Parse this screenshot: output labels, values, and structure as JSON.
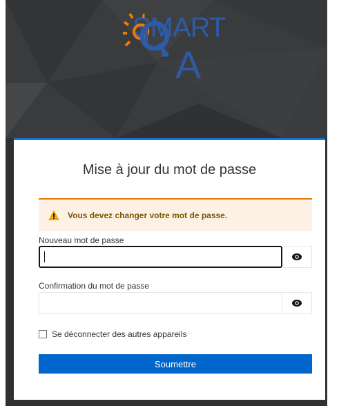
{
  "logo": {
    "text_top": "SMART",
    "text_bottom": "A",
    "brand_color": "#2e5aa6",
    "accent_color": "#ec7a08"
  },
  "card": {
    "title": "Mise à jour du mot de passe",
    "accent_color": "#1a73c8"
  },
  "alert": {
    "icon": "warning-icon",
    "message": "Vous devez changer votre mot de passe.",
    "background": "#fdf1e6",
    "border_color": "#ec7a08"
  },
  "new_password": {
    "label": "Nouveau mot de passe",
    "value": "",
    "toggle_icon": "eye-icon"
  },
  "confirm_password": {
    "label": "Confirmation du mot de passe",
    "value": "",
    "toggle_icon": "eye-icon"
  },
  "logout_other_devices": {
    "label": "Se déconnecter des autres appareils",
    "checked": false
  },
  "submit": {
    "label": "Soumettre",
    "color": "#0066cc"
  }
}
